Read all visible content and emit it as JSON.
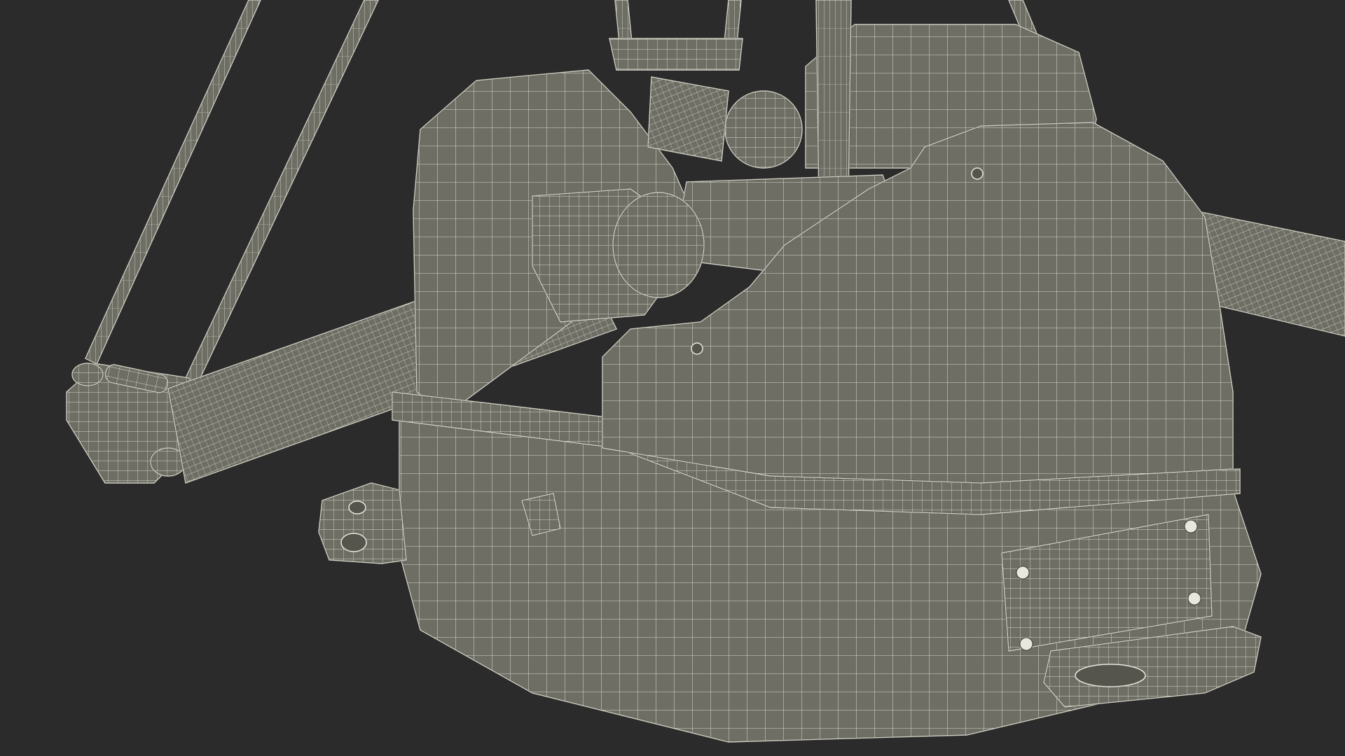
{
  "scene": {
    "background_color": "#2b2b2b",
    "mesh_fill_color": "#6e6e65",
    "mesh_shadow_color": "#55554e",
    "wire_color": "#e9e8dc",
    "edge_color": "#3e3e38"
  }
}
